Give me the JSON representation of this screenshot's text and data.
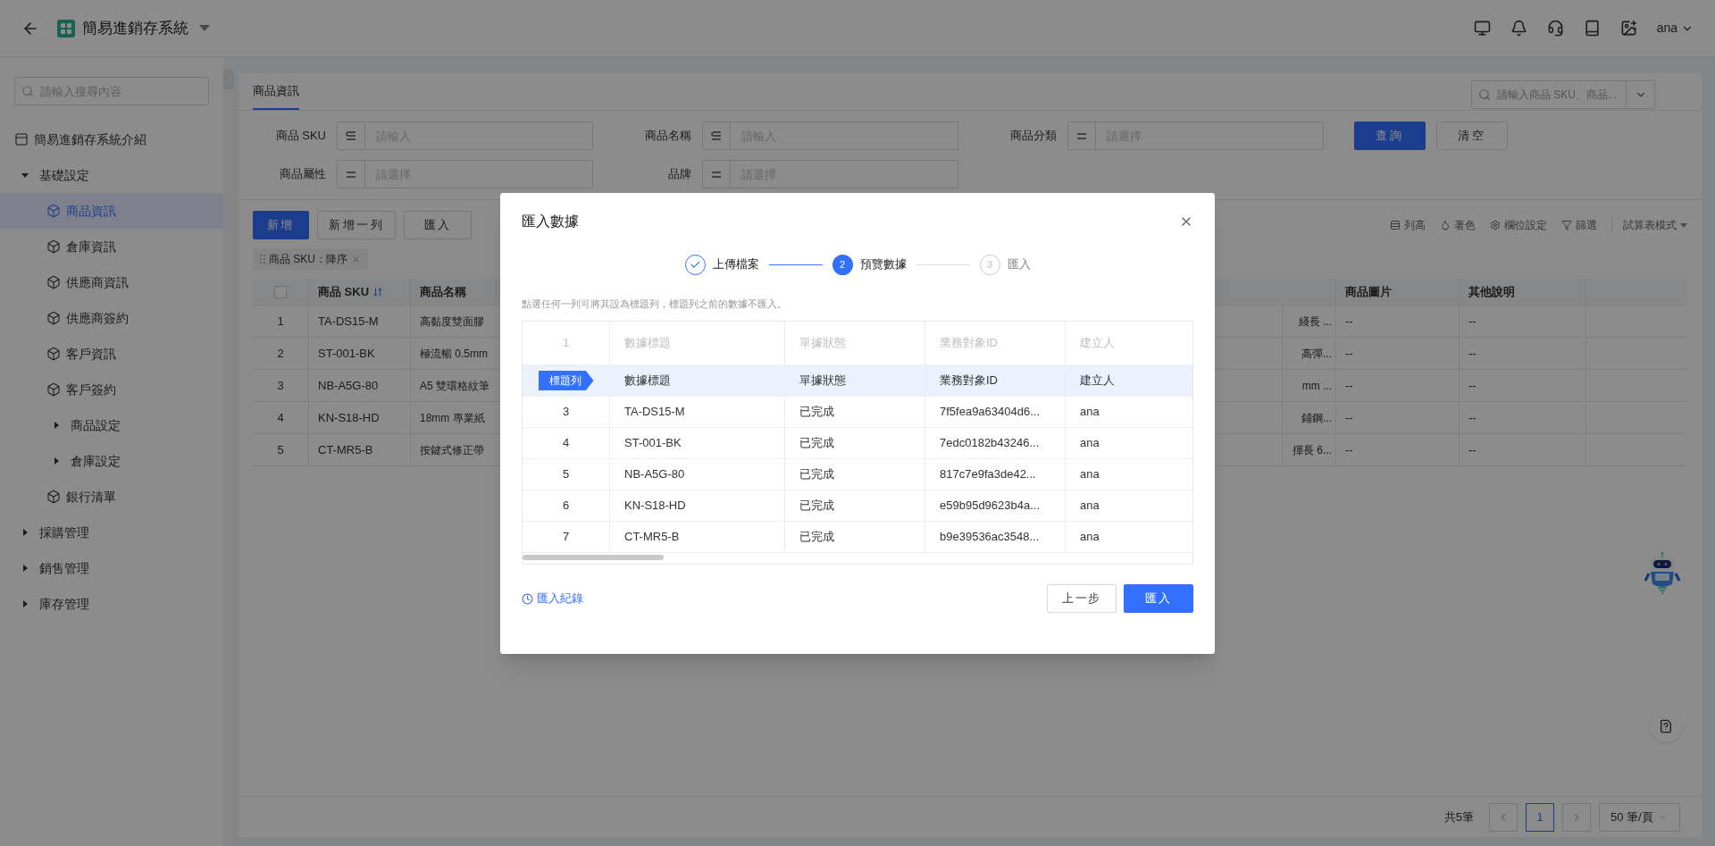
{
  "header": {
    "title": "簡易進銷存系統",
    "user": "ana"
  },
  "sidebar": {
    "search_placeholder": "請輸入搜尋內容",
    "items": [
      {
        "label": "簡易進銷存系統介紹",
        "kind": "intro",
        "selected": false
      },
      {
        "label": "基礎設定",
        "kind": "group",
        "expanded": true,
        "children": [
          {
            "label": "商品資訊",
            "kind": "page",
            "selected": true
          },
          {
            "label": "倉庫資訊",
            "kind": "page",
            "selected": false
          },
          {
            "label": "供應商資訊",
            "kind": "page",
            "selected": false
          },
          {
            "label": "供應商簽約",
            "kind": "page",
            "selected": false
          },
          {
            "label": "客戶資訊",
            "kind": "page",
            "selected": false
          },
          {
            "label": "客戶簽約",
            "kind": "page",
            "selected": false
          },
          {
            "label": "商品設定",
            "kind": "group",
            "expanded": false
          },
          {
            "label": "倉庫設定",
            "kind": "group",
            "expanded": false
          },
          {
            "label": "銀行清單",
            "kind": "page",
            "selected": false
          }
        ]
      },
      {
        "label": "採購管理",
        "kind": "group",
        "expanded": false
      },
      {
        "label": "銷售管理",
        "kind": "group",
        "expanded": false
      },
      {
        "label": "庫存管理",
        "kind": "group",
        "expanded": false
      }
    ]
  },
  "page": {
    "tabs": [
      {
        "label": "商品資訊",
        "selected": true
      }
    ],
    "search_placeholder": "請輸入商品 SKU、商品...",
    "filters": [
      {
        "label": "商品 SKU",
        "kind": "text",
        "placeholder": "請輸入"
      },
      {
        "label": "商品名稱",
        "kind": "text",
        "placeholder": "請輸入"
      },
      {
        "label": "商品分類",
        "kind": "select",
        "placeholder": "請選擇"
      },
      {
        "label": "商品屬性",
        "kind": "select",
        "placeholder": "請選擇"
      },
      {
        "label": "品牌",
        "kind": "select",
        "placeholder": "請選擇"
      }
    ],
    "filter_buttons": [
      {
        "label": "查詢",
        "kind": "primary"
      },
      {
        "label": "清空",
        "kind": "default"
      }
    ],
    "actions": [
      {
        "label": "新增",
        "kind": "primary"
      },
      {
        "label": "新增一列",
        "kind": "default"
      },
      {
        "label": "匯入",
        "kind": "default"
      }
    ],
    "tools": [
      {
        "label": "列高",
        "kind": "rows"
      },
      {
        "label": "著色",
        "kind": "color"
      },
      {
        "label": "欄位設定",
        "kind": "columns"
      },
      {
        "label": "篩選",
        "kind": "filter"
      },
      {
        "label": "試算表模式",
        "kind": "spreadsheet"
      }
    ],
    "sort_chip": "商品 SKU：降序",
    "table": {
      "select_all": false,
      "columns": [
        {
          "label": "商品 SKU",
          "sorted": true
        },
        {
          "label": "商品名稱",
          "sorted": false
        },
        {
          "label": "商品圖片",
          "sorted": false
        },
        {
          "label": "其他說明",
          "sorted": false
        }
      ],
      "rows": [
        {
          "number": "1",
          "checked": false,
          "product_sku": "TA-DS15-M",
          "product_name": "高黏度雙面膠",
          "column_5": "綫長 ...",
          "product_image": "--",
          "other_notes": "--"
        },
        {
          "number": "2",
          "checked": false,
          "product_sku": "ST-001-BK",
          "product_name": "極流暢 0.5mm",
          "column_5": "高彈...",
          "product_image": "--",
          "other_notes": "--"
        },
        {
          "number": "3",
          "checked": false,
          "product_sku": "NB-A5G-80",
          "product_name": "A5 雙環格紋筆",
          "column_5": "mm ...",
          "product_image": "--",
          "other_notes": "--"
        },
        {
          "number": "4",
          "checked": false,
          "product_sku": "KN-S18-HD",
          "product_name": "18mm 專業紙",
          "column_5": "鋪鋼...",
          "product_image": "--",
          "other_notes": "--"
        },
        {
          "number": "5",
          "checked": false,
          "product_sku": "CT-MR5-B",
          "product_name": "按鍵式修正帶",
          "column_5": "揮長 6...",
          "product_image": "--",
          "other_notes": "--"
        }
      ]
    },
    "pagination": {
      "total": "共5筆",
      "pages": [
        {
          "label": "1",
          "selected": true
        }
      ],
      "page_size": "50 筆/頁"
    }
  },
  "dialog": {
    "title": "匯入數據",
    "steps": [
      {
        "label": "上傳檔案",
        "done": true,
        "selected": false
      },
      {
        "number": "2",
        "label": "預覽數據",
        "done": false,
        "selected": true
      },
      {
        "number": "3",
        "label": "匯入",
        "done": false,
        "selected": false
      }
    ],
    "hint": "點選任何一列可將其設為標題列，標題列之前的數據不匯入。",
    "rows": [
      {
        "kind": "skipped",
        "selected": false,
        "marker": "1",
        "cells": [
          "數據標題",
          "單據狀態",
          "業務對象ID",
          "建立人"
        ]
      },
      {
        "kind": "title",
        "selected": true,
        "marker": "標題列",
        "cells": [
          "數據標題",
          "單據狀態",
          "業務對象ID",
          "建立人"
        ]
      },
      {
        "kind": "data",
        "selected": false,
        "marker": "3",
        "cells": [
          "TA-DS15-M",
          "已完成",
          "7f5fea9a63404d6...",
          "ana"
        ]
      },
      {
        "kind": "data",
        "selected": false,
        "marker": "4",
        "cells": [
          "ST-001-BK",
          "已完成",
          "7edc0182b43246...",
          "ana"
        ]
      },
      {
        "kind": "data",
        "selected": false,
        "marker": "5",
        "cells": [
          "NB-A5G-80",
          "已完成",
          "817c7e9fa3de42...",
          "ana"
        ]
      },
      {
        "kind": "data",
        "selected": false,
        "marker": "6",
        "cells": [
          "KN-S18-HD",
          "已完成",
          "e59b95d9623b4a...",
          "ana"
        ]
      },
      {
        "kind": "data",
        "selected": false,
        "marker": "7",
        "cells": [
          "CT-MR5-B",
          "已完成",
          "b9e39536ac3548...",
          "ana"
        ]
      }
    ],
    "history_link": "匯入紀錄",
    "buttons": [
      {
        "label": "上一步",
        "kind": "default"
      },
      {
        "label": "匯入",
        "kind": "primary"
      }
    ]
  }
}
